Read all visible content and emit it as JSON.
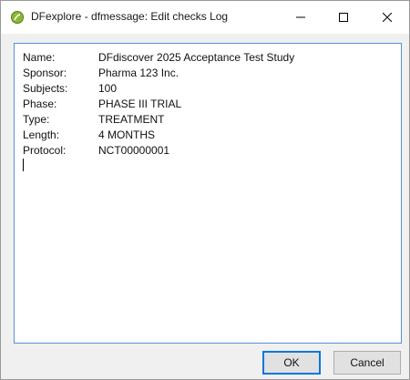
{
  "window": {
    "title": "DFexplore - dfmessage: Edit checks Log"
  },
  "log": {
    "lines": [
      {
        "label": "Name:",
        "value": "DFdiscover 2025 Acceptance Test Study"
      },
      {
        "label": "Sponsor:",
        "value": "Pharma 123 Inc."
      },
      {
        "label": "Subjects:",
        "value": "100"
      },
      {
        "label": "Phase:",
        "value": "PHASE III TRIAL"
      },
      {
        "label": "Type:",
        "value": "TREATMENT"
      },
      {
        "label": "Length:",
        "value": "4 MONTHS"
      },
      {
        "label": "Protocol:",
        "value": "NCT00000001"
      }
    ]
  },
  "buttons": {
    "ok_label": "OK",
    "cancel_label": "Cancel"
  },
  "icons": {
    "app": "dfexplore-app-icon",
    "minimize": "minimize-icon",
    "maximize": "maximize-icon",
    "close": "close-icon"
  },
  "colors": {
    "app_icon": "#8bb83a",
    "focus_border": "#5a8fd6",
    "default_button_border": "#0078d7"
  }
}
